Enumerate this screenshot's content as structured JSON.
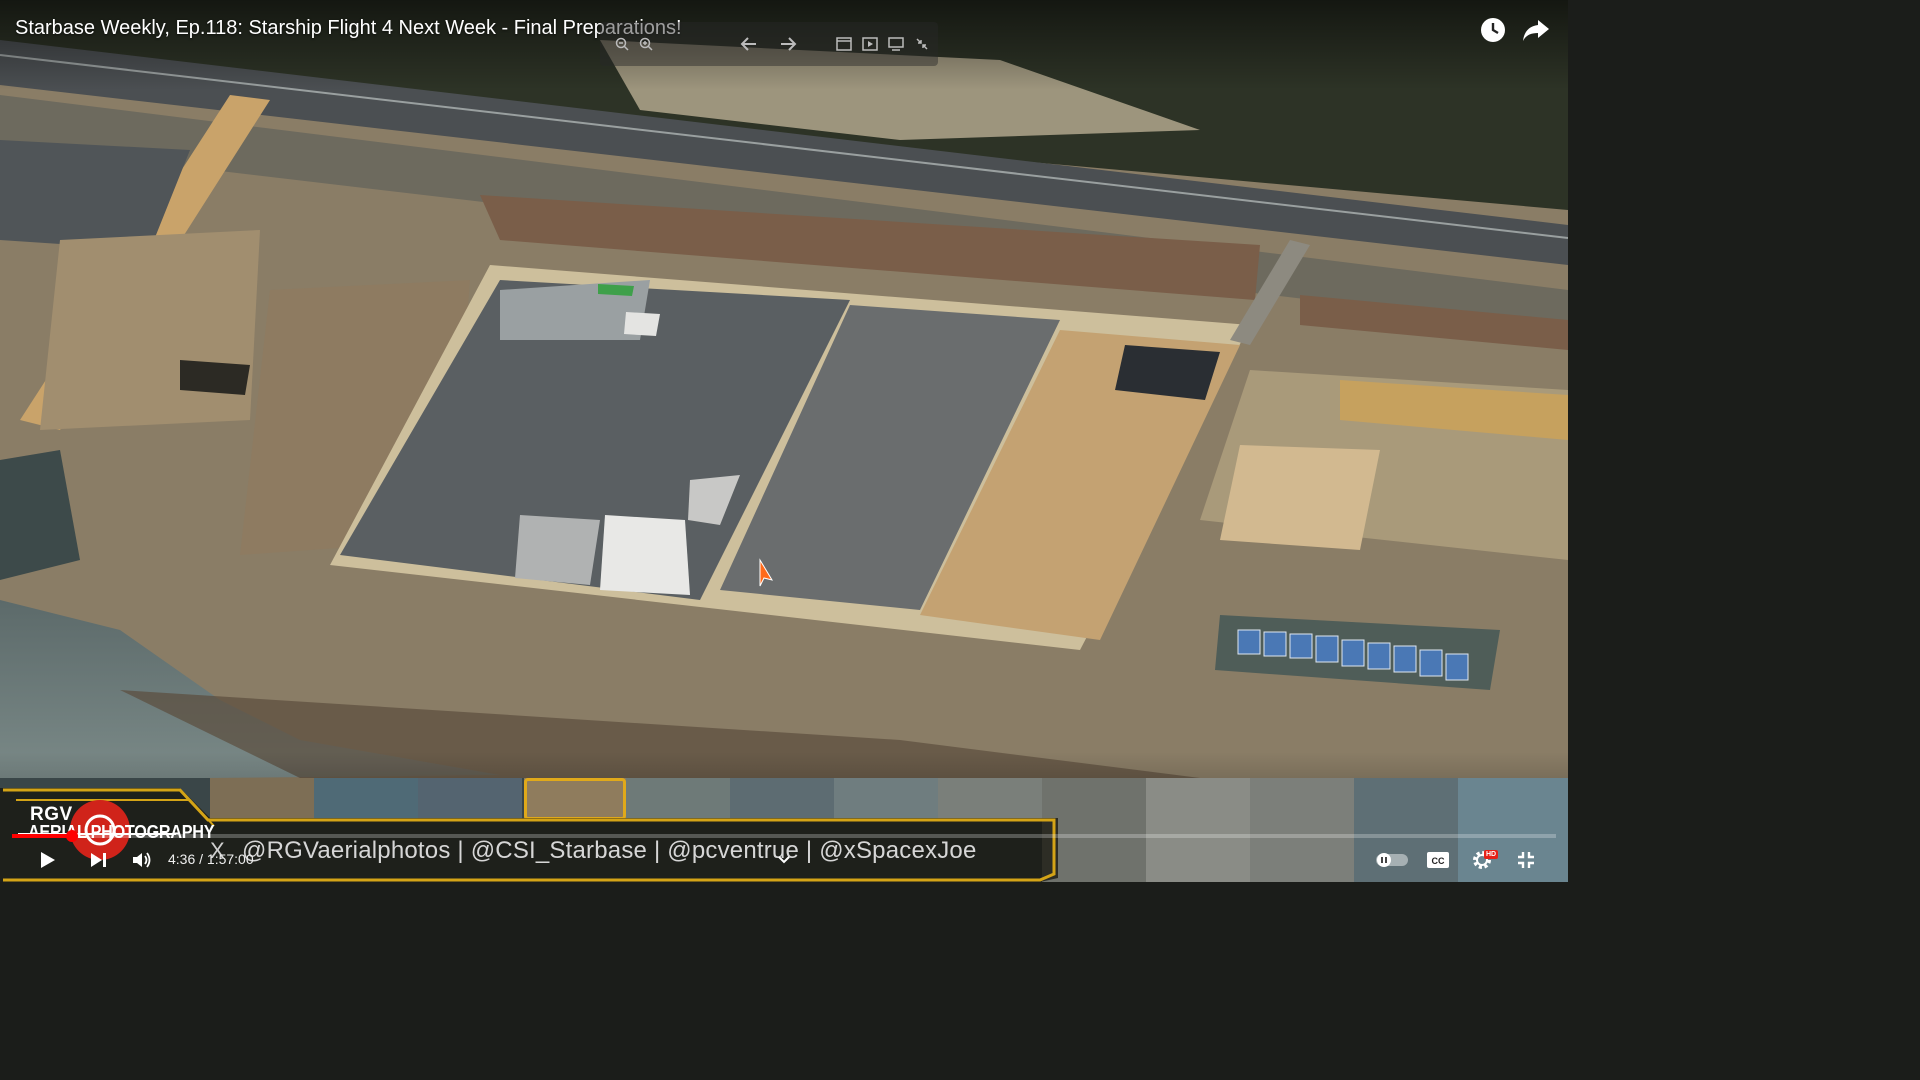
{
  "video": {
    "title": "Starbase Weekly, Ep.118: Starship Flight 4 Next Week - Final Preparations!"
  },
  "top_actions": [
    {
      "icon": "watch-later-icon"
    },
    {
      "icon": "share-icon"
    }
  ],
  "overlay_toolbar": [
    {
      "icon": "zoom-out-icon"
    },
    {
      "icon": "zoom-in-icon"
    },
    {
      "icon": "arrow-left-icon"
    },
    {
      "icon": "arrow-right-icon"
    },
    {
      "icon": "window-icon"
    },
    {
      "icon": "play-box-icon"
    },
    {
      "icon": "screen-icon"
    },
    {
      "icon": "collapse-icon"
    }
  ],
  "branding": {
    "logo_line1": "RGV",
    "logo_line2": "AERIAL PHOTOGRAPHY",
    "x_icon": "X",
    "credits": "@RGVaerialphotos | @CSI_Starbase | @pcventrue | @xSpacexJoe"
  },
  "controls": {
    "time_current": "4:36",
    "time_separator": " / ",
    "time_total": "1:57:00",
    "progress_fraction": 0.039,
    "hd_badge": "HD"
  },
  "colors": {
    "progress": "#ff0000",
    "accent_gold": "#e0a91a",
    "hd_badge": "#e62117"
  }
}
